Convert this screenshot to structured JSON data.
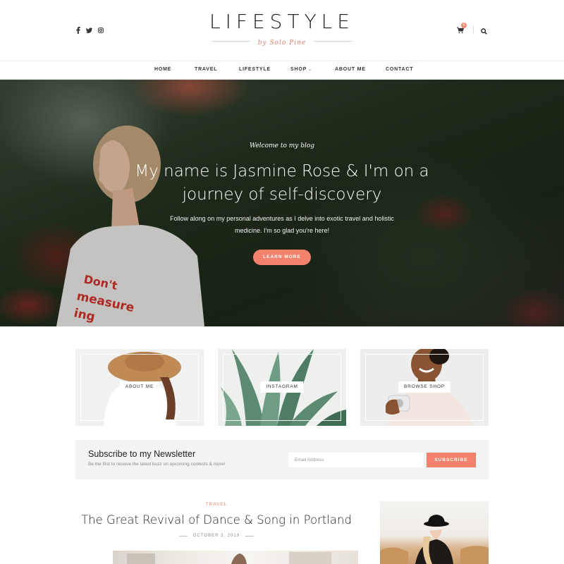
{
  "header": {
    "logo_title": "LIFESTYLE",
    "logo_subtitle": "by Solo Pine",
    "social_icons": [
      "facebook-icon",
      "twitter-icon",
      "instagram-icon"
    ],
    "cart_count": "0"
  },
  "nav": {
    "items": [
      "HOME",
      "TRAVEL",
      "LIFESTYLE",
      "SHOP",
      "ABOUT ME",
      "CONTACT"
    ]
  },
  "hero": {
    "overline": "Welcome to my blog",
    "title": "My name is Jasmine Rose & I'm on a journey of self-discovery",
    "text": "Follow along on my personal adventures as I delve into exotic travel and holistic medicine. I'm so glad you're here!",
    "button": "LEARN MORE"
  },
  "features": [
    {
      "label": "ABOUT ME"
    },
    {
      "label": "INSTAGRAM"
    },
    {
      "label": "BROWSE SHOP"
    }
  ],
  "newsletter": {
    "title": "Subscribe to my Newsletter",
    "subtitle": "Be the first to receive the latest buzz on upcoming contests & more!",
    "placeholder": "Email Address",
    "button": "SUBSCRIBE"
  },
  "post": {
    "category": "TRAVEL",
    "title": "The Great Revival of Dance & Song in Portland",
    "date": "OCTOBER 3, 2019"
  },
  "colors": {
    "accent": "#f2826c",
    "text": "#222222",
    "muted": "#888888"
  }
}
